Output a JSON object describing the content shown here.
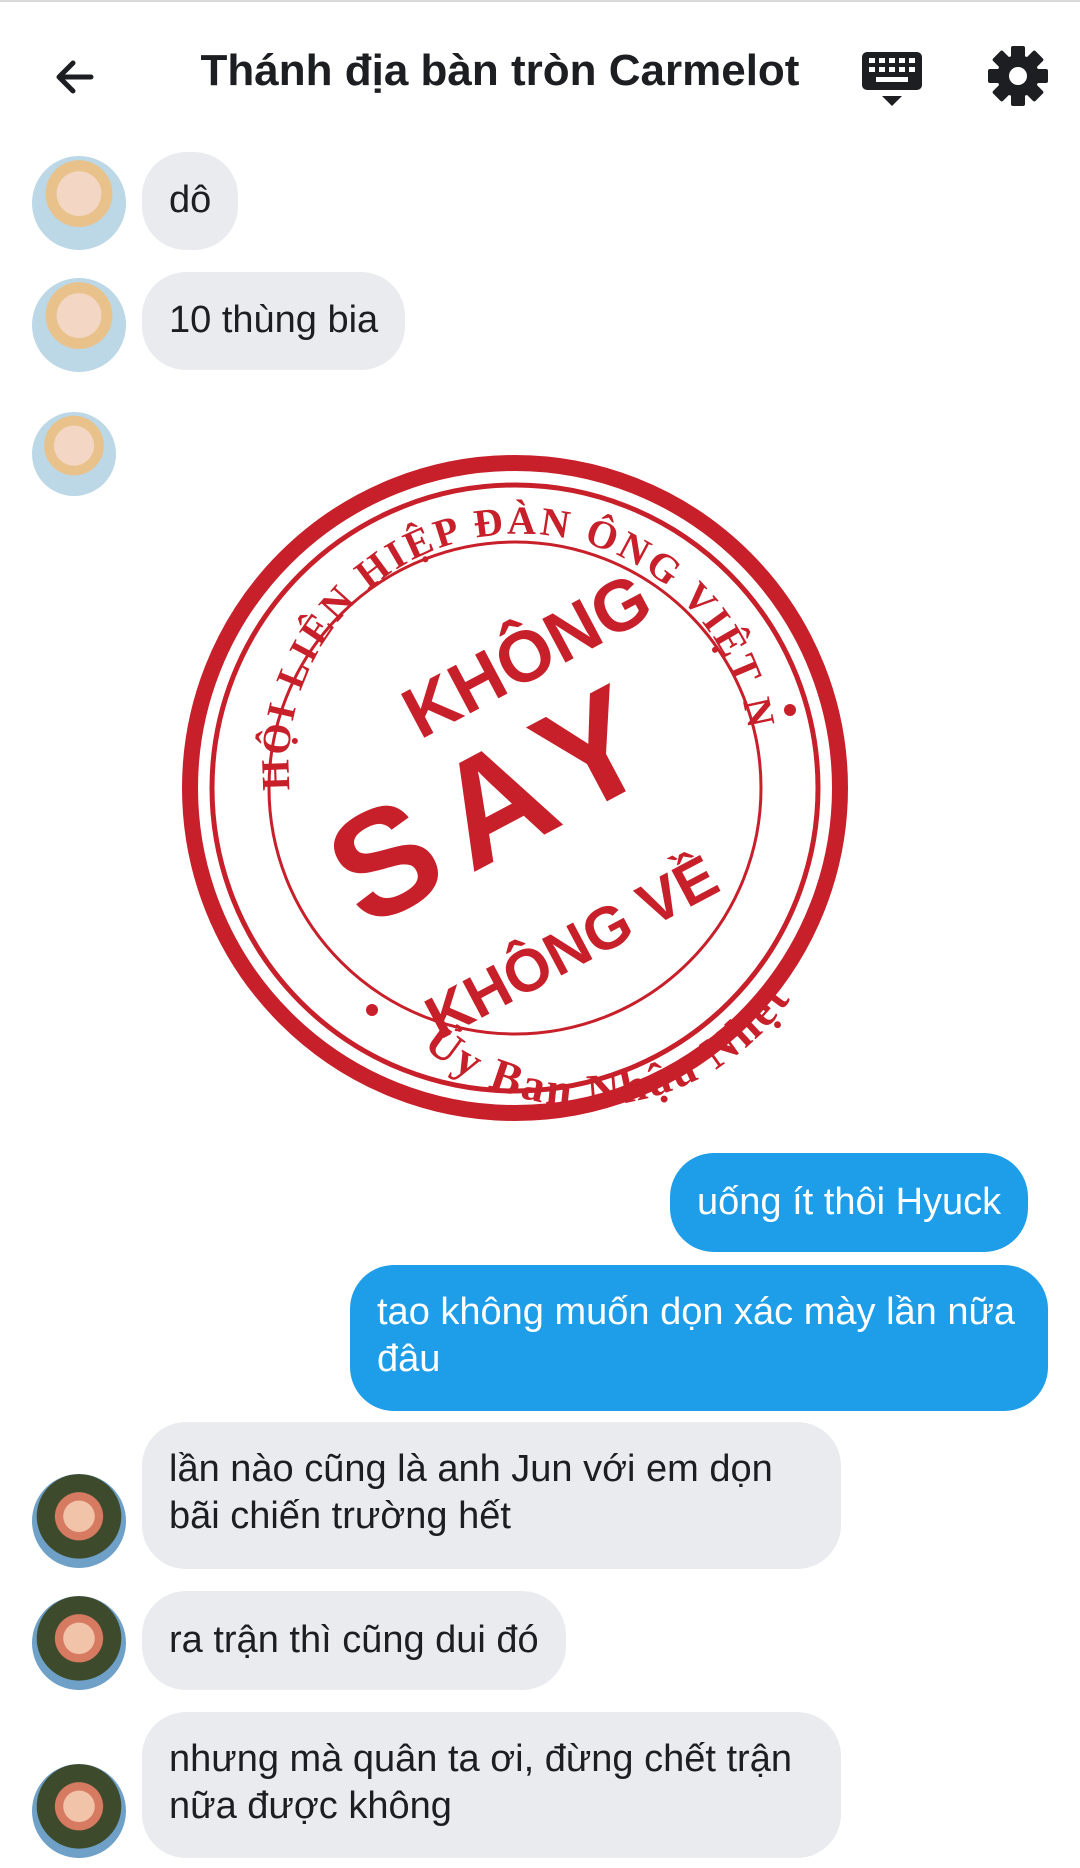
{
  "header": {
    "title": "Thánh địa bàn tròn Carmelot",
    "back_icon": "back-arrow-icon",
    "keyboard_icon": "keyboard-icon",
    "settings_icon": "gear-icon"
  },
  "messages": [
    {
      "from": "other",
      "text": "dô"
    },
    {
      "from": "other",
      "text": "10 thùng bia"
    },
    {
      "from": "other",
      "type": "sticker"
    },
    {
      "from": "me",
      "text": "uống ít thôi Hyuck"
    },
    {
      "from": "me",
      "text": "tao không muốn dọn xác mày lần nữa đâu"
    },
    {
      "from": "other",
      "text": "lần nào cũng là anh Jun với em dọn bãi chiến trường hết"
    },
    {
      "from": "other",
      "text": "ra trận thì cũng dui đó"
    },
    {
      "from": "other",
      "text": "nhưng mà quân ta ơi, đừng chết trận nữa được không"
    }
  ],
  "sticker": {
    "outer_text": "HỘI LIÊN HIỆP ĐÀN ÔNG VIỆT NAM",
    "bottom_text": "Ủy Ban Nhậu Nhẹt",
    "line1": "KHÔNG",
    "line2": "SAY",
    "line3": "KHÔNG VỀ"
  },
  "colors": {
    "outgoing_bubble": "#1e9de8",
    "incoming_bubble": "#e9ebee",
    "stamp_red": "#c8202a"
  }
}
